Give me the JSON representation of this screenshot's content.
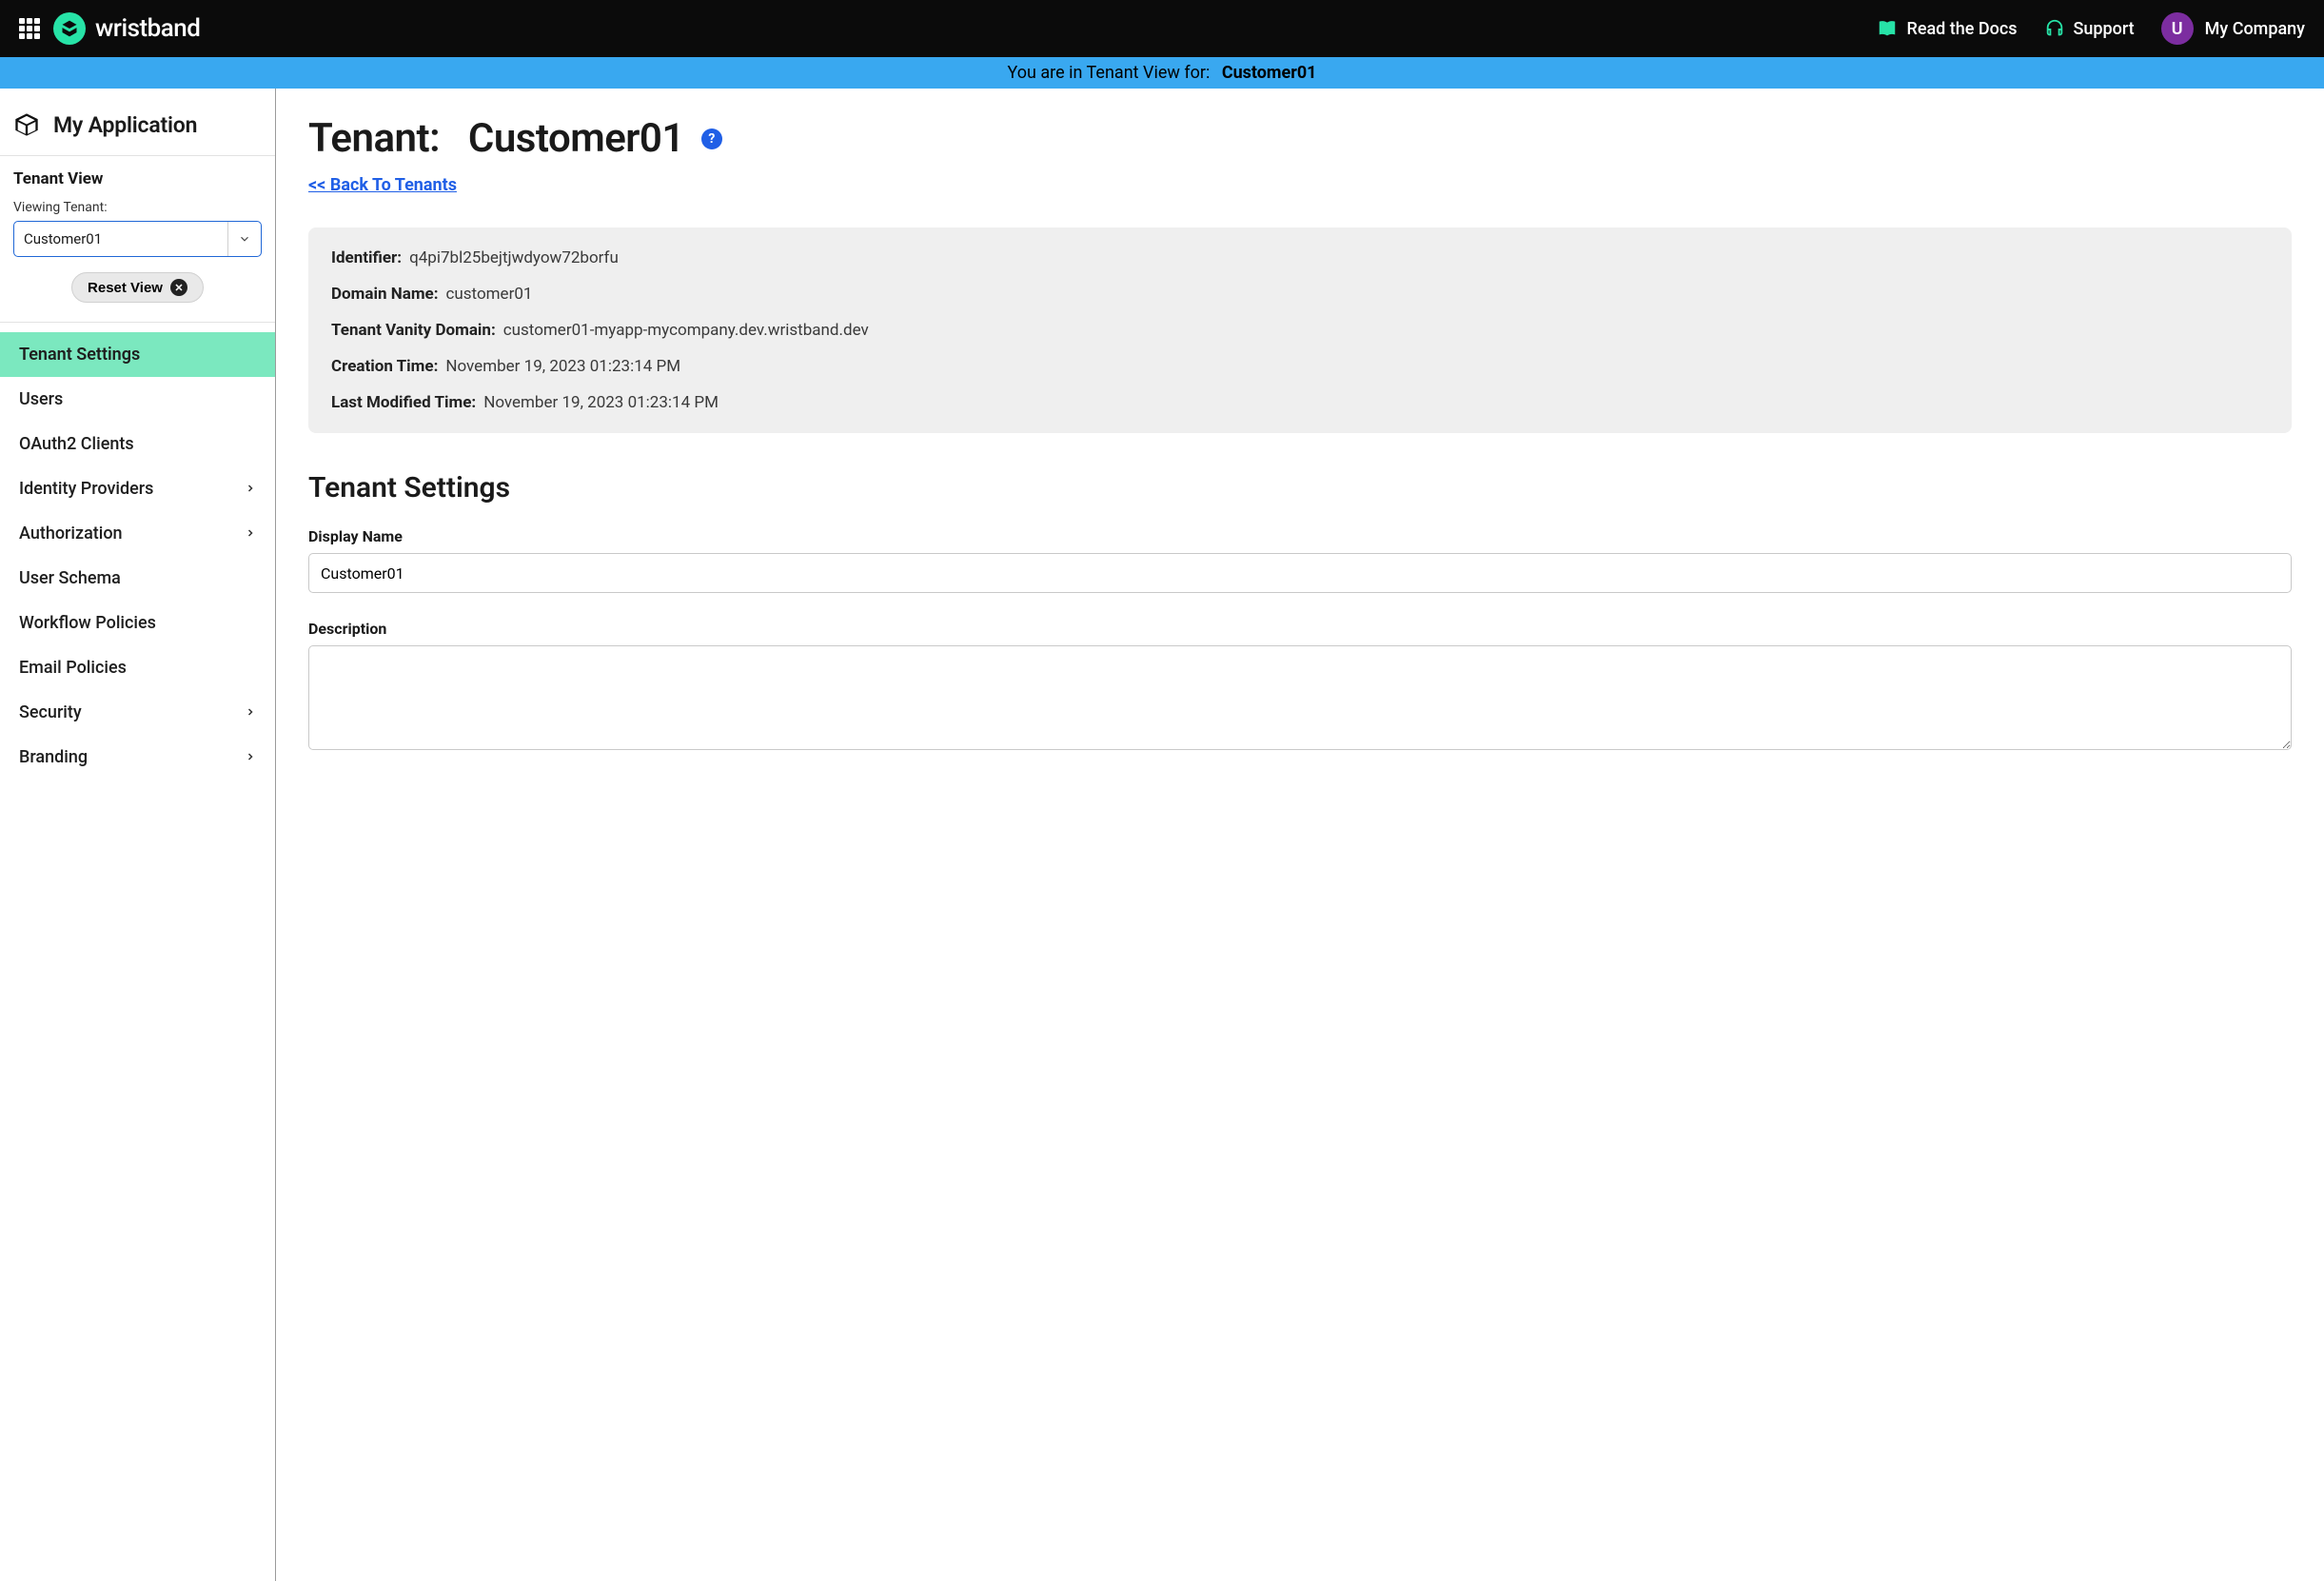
{
  "header": {
    "brand_name": "wristband",
    "docs_label": "Read the Docs",
    "support_label": "Support",
    "company_label": "My Company",
    "avatar_letter": "U"
  },
  "banner": {
    "prefix": "You are in Tenant View for:",
    "tenant": "Customer01"
  },
  "sidebar": {
    "app_title": "My Application",
    "section_label": "Tenant View",
    "viewing_label": "Viewing Tenant:",
    "selected_tenant": "Customer01",
    "reset_label": "Reset View",
    "nav": [
      {
        "label": "Tenant Settings",
        "expandable": false,
        "active": true
      },
      {
        "label": "Users",
        "expandable": false,
        "active": false
      },
      {
        "label": "OAuth2 Clients",
        "expandable": false,
        "active": false
      },
      {
        "label": "Identity Providers",
        "expandable": true,
        "active": false
      },
      {
        "label": "Authorization",
        "expandable": true,
        "active": false
      },
      {
        "label": "User Schema",
        "expandable": false,
        "active": false
      },
      {
        "label": "Workflow Policies",
        "expandable": false,
        "active": false
      },
      {
        "label": "Email Policies",
        "expandable": false,
        "active": false
      },
      {
        "label": "Security",
        "expandable": true,
        "active": false
      },
      {
        "label": "Branding",
        "expandable": true,
        "active": false
      }
    ]
  },
  "page": {
    "title_prefix": "Tenant:",
    "title_name": "Customer01",
    "help_glyph": "?",
    "back_link": "<< Back To Tenants"
  },
  "info": {
    "rows": [
      {
        "k": "Identifier:",
        "v": "q4pi7bl25bejtjwdyow72borfu"
      },
      {
        "k": "Domain Name:",
        "v": "customer01"
      },
      {
        "k": "Tenant Vanity Domain:",
        "v": "customer01-myapp-mycompany.dev.wristband.dev"
      },
      {
        "k": "Creation Time:",
        "v": "November 19, 2023 01:23:14 PM"
      },
      {
        "k": "Last Modified Time:",
        "v": "November 19, 2023 01:23:14 PM"
      }
    ]
  },
  "settings": {
    "section_title": "Tenant Settings",
    "display_name_label": "Display Name",
    "display_name_value": "Customer01",
    "description_label": "Description",
    "description_value": ""
  }
}
